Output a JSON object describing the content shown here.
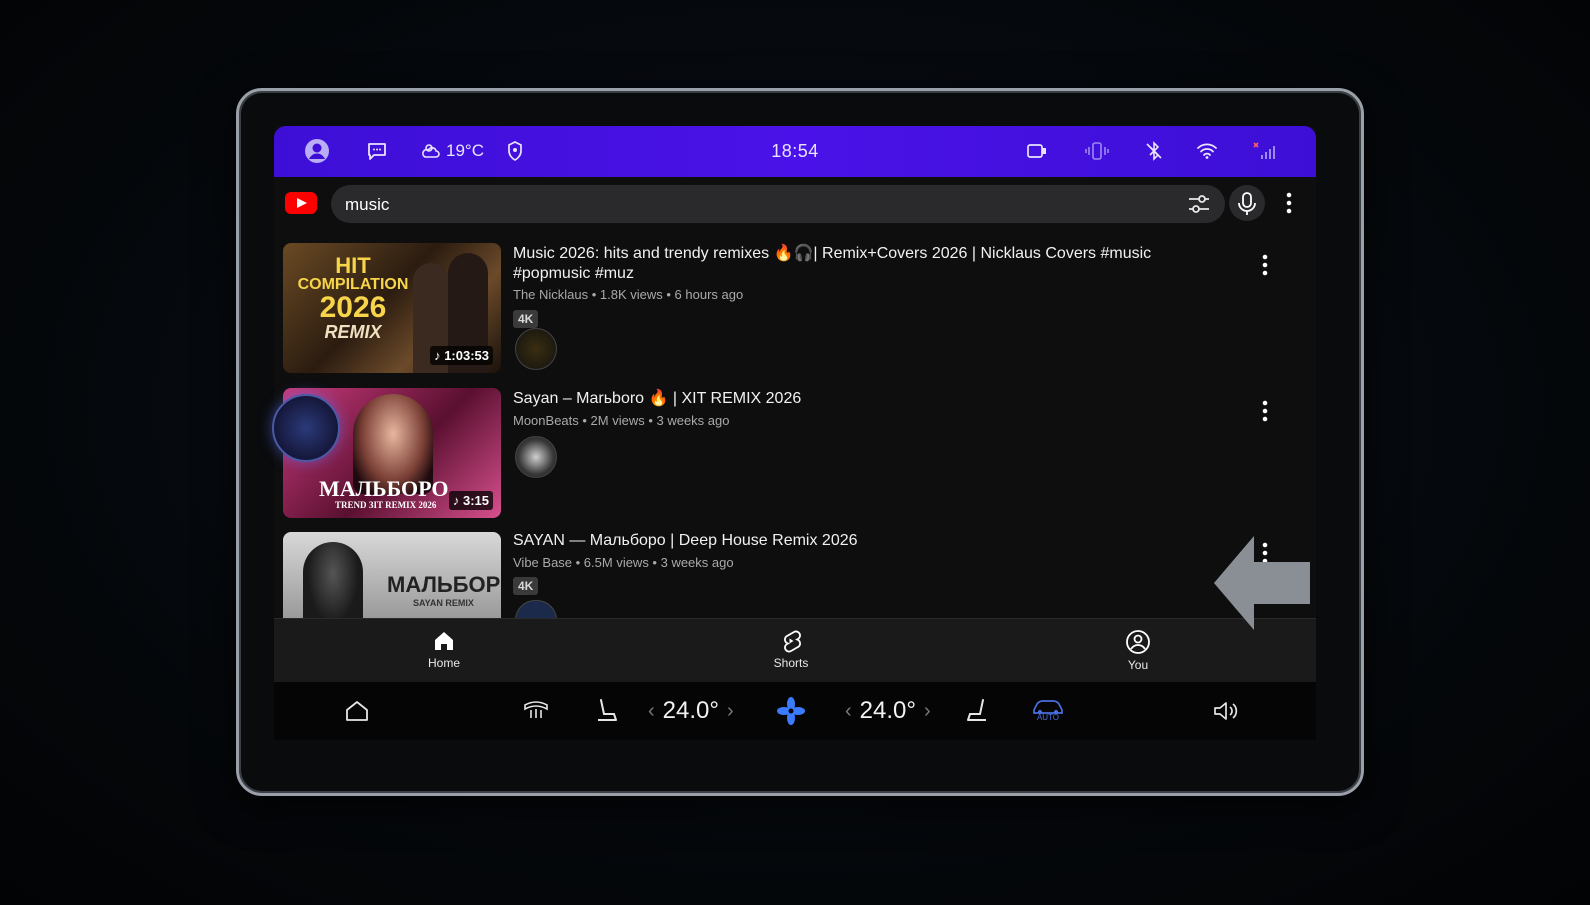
{
  "status_bar": {
    "weather": "19°C",
    "time": "18:54"
  },
  "search": {
    "query": "music"
  },
  "results": [
    {
      "title": "Music 2026: hits and trendy remixes 🔥🎧| Remix+Covers 2026 | Nicklaus Covers #music #popmusic #muz",
      "meta": "The Nicklaus • 1.8K views • 6 hours ago",
      "badge": "4K",
      "duration": "1:03:53",
      "thumb_lines": [
        "HIT",
        "COMPILATION",
        "2026",
        "REMIX"
      ]
    },
    {
      "title": "Sayan – Marьboro 🔥 | XIT REMIX 2026",
      "meta": "MoonBeats • 2M views • 3 weeks ago",
      "duration": "3:15",
      "thumb_lines": [
        "МАЛЬБОРО",
        "TREND ЗIT REMIX 2026"
      ]
    },
    {
      "title": "SAYAN — Мальборо | Deep House Remix 2026",
      "meta": "Vibe Base • 6.5M views • 3 weeks ago",
      "badge": "4K",
      "thumb_lines": [
        "МАЛЬБОРО",
        "SAYAN REMIX"
      ]
    }
  ],
  "nav": {
    "home": "Home",
    "shorts": "Shorts",
    "you": "You"
  },
  "climate": {
    "left_temp": "24.0°",
    "right_temp": "24.0°",
    "auto_label": "AUTO"
  },
  "colors": {
    "status_bar": "#4a12e8",
    "youtube_red": "#ff0000",
    "fan_accent": "#3a7bff"
  }
}
